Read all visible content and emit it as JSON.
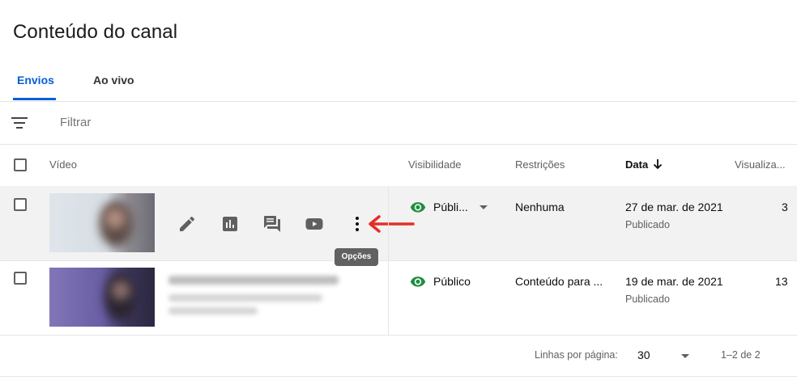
{
  "page_title": "Conteúdo do canal",
  "tabs": [
    {
      "label": "Envios",
      "active": true
    },
    {
      "label": "Ao vivo",
      "active": false
    }
  ],
  "filter": {
    "placeholder": "Filtrar"
  },
  "columns": {
    "video": "Vídeo",
    "visibility": "Visibilidade",
    "restrictions": "Restrições",
    "date": "Data",
    "views": "Visualiza..."
  },
  "rows": [
    {
      "visibility": "Públi...",
      "restrictions": "Nenhuma",
      "date": "27 de mar. de 2021",
      "status": "Publicado",
      "views": "3"
    },
    {
      "visibility": "Público",
      "restrictions": "Conteúdo para ...",
      "date": "19 de mar. de 2021",
      "status": "Publicado",
      "views": "13"
    }
  ],
  "row_actions": [
    "pencil-icon",
    "analytics-icon",
    "comments-icon",
    "youtube-icon",
    "more-vert-icon"
  ],
  "tooltip": "Opções",
  "pagination": {
    "rows_per_page_label": "Linhas por página:",
    "rows_per_page_value": "30",
    "range": "1–2 de 2"
  },
  "colors": {
    "accent": "#065fd4",
    "visibility_green": "#1e8e3e",
    "annotation_red": "#e52d27",
    "row_highlight": "#f2f2f2"
  }
}
